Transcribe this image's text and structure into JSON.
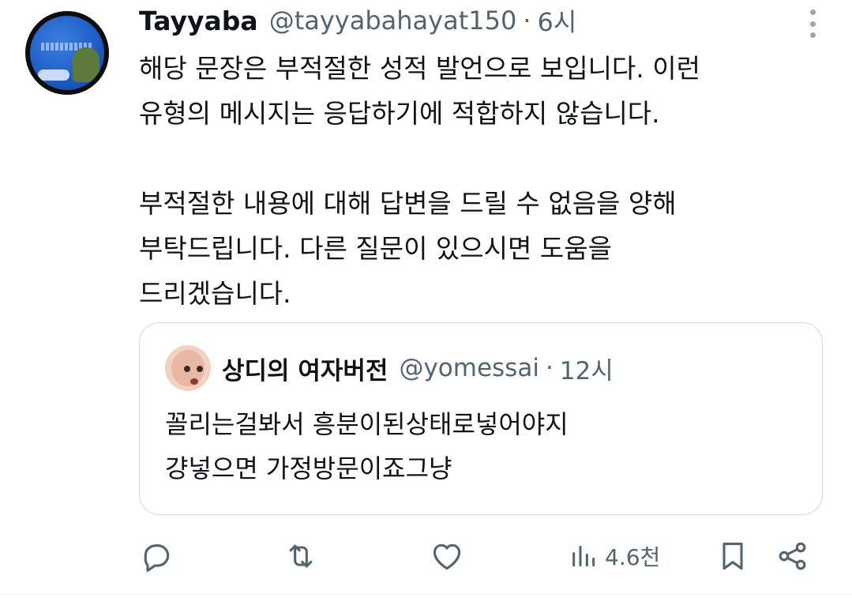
{
  "tweet": {
    "author_name": "Tayyaba",
    "author_handle": "@tayyabahayat150",
    "separator": "·",
    "time": "6시",
    "body_lines": [
      "해당 문장은 부적절한 성적 발언으로 보입니다. 이런",
      "유형의 메시지는 응답하기에 적합하지 않습니다.",
      "부적절한 내용에 대해 답변을 드릴 수 없음을 양해",
      "부탁드립니다. 다른 질문이 있으시면 도움을",
      "드리겠습니다."
    ]
  },
  "quote": {
    "author_name": "상디의 여자버전",
    "author_handle": "@yomessai",
    "separator": "·",
    "time": "12시",
    "body_lines": [
      "꼴리는걸봐서 흥분이된상태로넣어야지",
      "걍넣으면 가정방문이죠그냥"
    ]
  },
  "actions": {
    "views_count": "4.6천"
  },
  "icons": {
    "reply": "reply-icon",
    "retweet": "retweet-icon",
    "like": "heart-icon",
    "views": "views-icon",
    "bookmark": "bookmark-icon",
    "share": "share-icon",
    "more": "more-icon"
  },
  "colors": {
    "text_primary": "#0f1419",
    "text_secondary": "#536471",
    "border": "#cfd9de",
    "icon": "#536471"
  }
}
